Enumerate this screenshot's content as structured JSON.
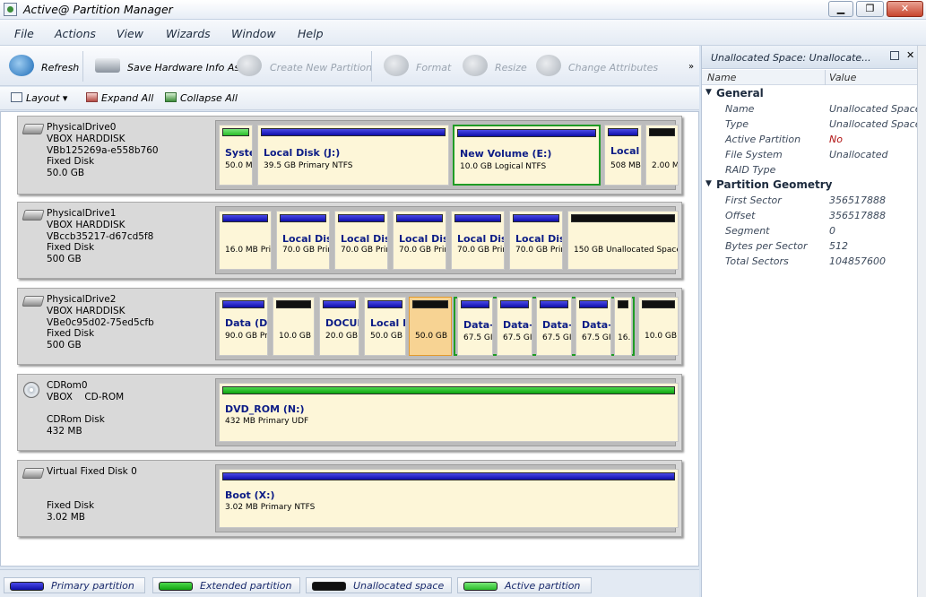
{
  "window": {
    "title": "Active@ Partition Manager",
    "min": "▁",
    "max": "❐",
    "close": "✕"
  },
  "menu": [
    "File",
    "Actions",
    "View",
    "Wizards",
    "Window",
    "Help"
  ],
  "toolbar": {
    "refresh": "Refresh",
    "save_hw": "Save Hardware Info As",
    "create": "Create New Partition",
    "format": "Format",
    "resize": "Resize",
    "change": "Change Attributes",
    "more": "»"
  },
  "toolbar2": {
    "layout": "Layout",
    "expand": "Expand All",
    "collapse": "Collapse All"
  },
  "disks": [
    {
      "info": "PhysicalDrive0\nVBOX HARDDISK\nVBb125269a-e558b760\nFixed Disk\n50.0 GB",
      "partitions": [
        {
          "type": "active",
          "name": "Syste",
          "desc": "50.0 ME"
        },
        {
          "type": "primary",
          "name": "Local Disk (J:)",
          "desc": "39.5 GB Primary NTFS"
        },
        {
          "type": "primary",
          "name": "New Volume (E:)",
          "desc": "10.0 GB Logical NTFS"
        },
        {
          "type": "primary",
          "name": "Local",
          "desc": "508 MB"
        },
        {
          "type": "unalloc",
          "name": "",
          "desc": "2.00 M"
        }
      ]
    },
    {
      "info": "PhysicalDrive1\nVBOX HARDDISK\nVBccb35217-d67cd5f8\nFixed Disk\n500 GB",
      "partitions": [
        {
          "type": "primary",
          "name": "",
          "desc": "16.0 MB Prin"
        },
        {
          "type": "primary",
          "name": "Local Disl",
          "desc": "70.0 GB Prin"
        },
        {
          "type": "primary",
          "name": "Local Disl",
          "desc": "70.0 GB Prin"
        },
        {
          "type": "primary",
          "name": "Local Disl",
          "desc": "70.0 GB Prin"
        },
        {
          "type": "primary",
          "name": "Local Disl",
          "desc": "70.0 GB Prin"
        },
        {
          "type": "primary",
          "name": "Local Disl",
          "desc": "70.0 GB Prin"
        },
        {
          "type": "unalloc",
          "name": "",
          "desc": "150 GB Unallocated Space"
        }
      ]
    },
    {
      "info": "PhysicalDrive2\nVBOX HARDDISK\nVBe0c95d02-75ed5cfb\nFixed Disk\n500 GB",
      "partitions": [
        {
          "type": "primary",
          "name": "Data (D:)",
          "desc": "90.0 GB Pri"
        },
        {
          "type": "unalloc",
          "name": "",
          "desc": "10.0 GB"
        },
        {
          "type": "primary",
          "name": "DOCUM",
          "desc": "20.0 GB"
        },
        {
          "type": "primary",
          "name": "Local D",
          "desc": "50.0 GB"
        },
        {
          "type": "unalloc",
          "name": "",
          "desc": "50.0 GB"
        },
        {
          "type": "primary",
          "name": "Data-",
          "desc": "67.5 GI"
        },
        {
          "type": "primary",
          "name": "Data-",
          "desc": "67.5 GI"
        },
        {
          "type": "primary",
          "name": "Data-",
          "desc": "67.5 GI"
        },
        {
          "type": "primary",
          "name": "Data-",
          "desc": "67.5 GI"
        },
        {
          "type": "unalloc",
          "name": "",
          "desc": "16."
        },
        {
          "type": "unalloc",
          "name": "",
          "desc": "10.0 GB"
        }
      ]
    },
    {
      "info": "CDRom0\nVBOX    CD-ROM\n\nCDRom Disk\n432 MB",
      "partitions": [
        {
          "type": "extended",
          "name": "DVD_ROM (N:)",
          "desc": "432 MB Primary UDF"
        }
      ]
    },
    {
      "info": "Virtual Fixed Disk 0\n\n\nFixed Disk\n3.02 MB",
      "partitions": [
        {
          "type": "primary",
          "name": "Boot (X:)",
          "desc": "3.02 MB Primary NTFS"
        }
      ]
    }
  ],
  "legend": [
    {
      "label": "Primary partition",
      "type": "primary"
    },
    {
      "label": "Extended partition",
      "type": "extended"
    },
    {
      "label": "Unallocated space",
      "type": "unalloc"
    },
    {
      "label": "Active partition",
      "type": "active"
    }
  ],
  "properties": {
    "title": "Unallocated Space: Unallocate...",
    "col_name": "Name",
    "col_value": "Value",
    "general": {
      "label": "General",
      "rows": [
        {
          "k": "Name",
          "v": "Unallocated Space"
        },
        {
          "k": "Type",
          "v": "Unallocated Space"
        },
        {
          "k": "Active Partition",
          "v": "No"
        },
        {
          "k": "File System",
          "v": "Unallocated"
        },
        {
          "k": "RAID Type",
          "v": ""
        }
      ]
    },
    "geometry": {
      "label": "Partition Geometry",
      "rows": [
        {
          "k": "First Sector",
          "v": "356517888"
        },
        {
          "k": "Offset",
          "v": "356517888"
        },
        {
          "k": "Segment",
          "v": "0"
        },
        {
          "k": "Bytes per Sector",
          "v": "512"
        },
        {
          "k": "Total Sectors",
          "v": "104857600"
        }
      ]
    }
  },
  "colors": {
    "primary": "#1010b0",
    "extended": "#10a810",
    "unallocated": "#101010",
    "active": "#2ac02a",
    "selected": "#f7d393"
  }
}
